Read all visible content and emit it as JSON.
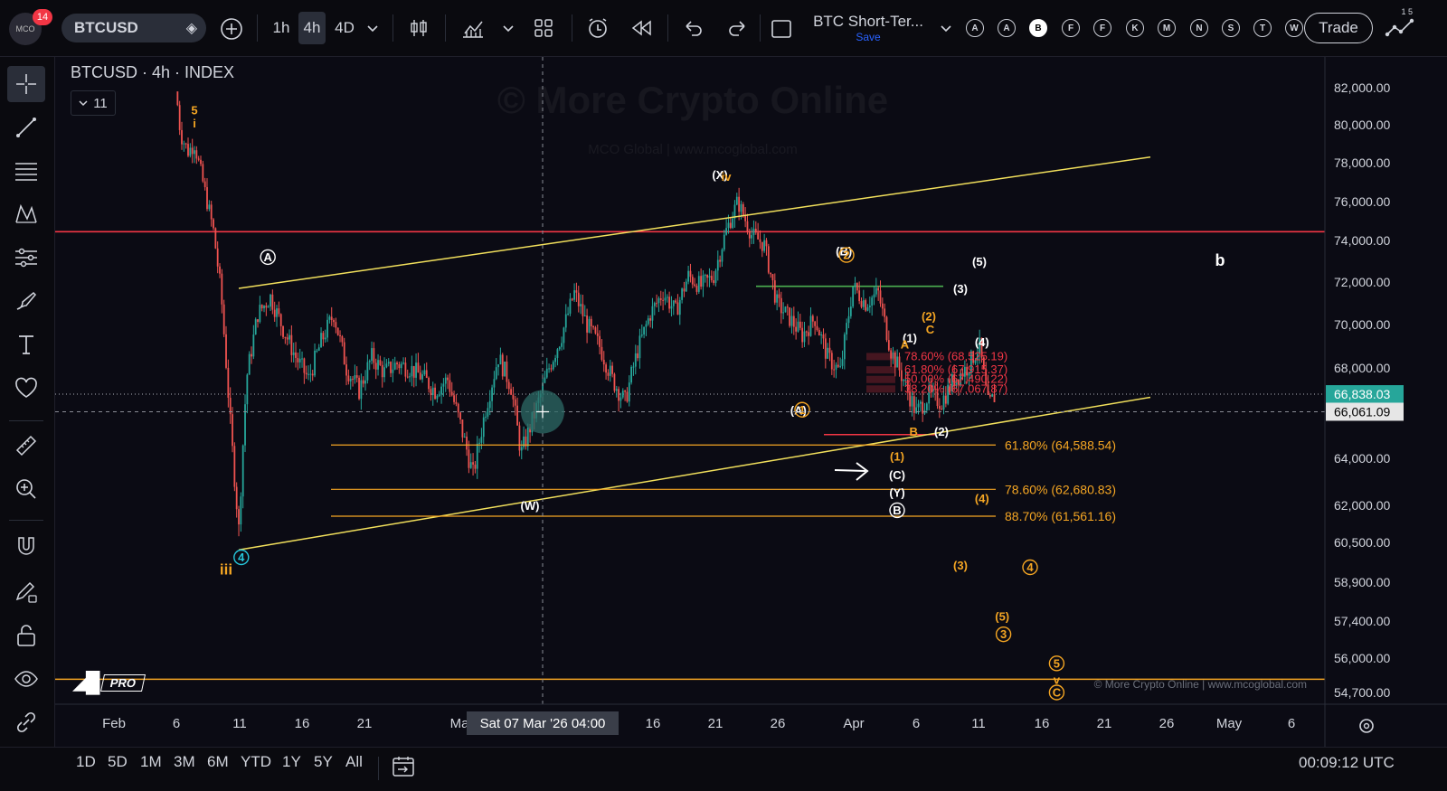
{
  "topbar": {
    "avatar_badge": "14",
    "symbol": "BTCUSD",
    "intervals": [
      "1h",
      "4h",
      "4D"
    ],
    "active_interval": "4h",
    "layout_name": "BTC Short-Ter...",
    "save_label": "Save",
    "letter_buttons": [
      "A",
      "A",
      "B",
      "F",
      "F",
      "K",
      "M",
      "N",
      "S",
      "T",
      "W"
    ],
    "active_letter": "B",
    "trade_label": "Trade",
    "corner_numbers": "1 5"
  },
  "chart_header": {
    "title": "BTCUSD · 4h · INDEX",
    "collapse_count": "11"
  },
  "watermark": {
    "main": "© More Crypto Online",
    "sub": "MCO Global  |  www.mcoglobal.com",
    "footer": "© More Crypto Online  |  www.mcoglobal.com",
    "logo_text": "PRO"
  },
  "crosshair": {
    "date_label": "Sat 07 Mar '26   04:00",
    "price_label": "66,061.09"
  },
  "bottombar": {
    "ranges": [
      "1D",
      "5D",
      "1M",
      "3M",
      "6M",
      "YTD",
      "1Y",
      "5Y",
      "All"
    ],
    "clock": "00:09:12 UTC"
  },
  "chart_data": {
    "type": "candlestick",
    "symbol": "BTCUSD",
    "interval": "4h",
    "ylim": [
      54000,
      83000
    ],
    "y_ticks": [
      82000,
      80000,
      78000,
      76000,
      74000,
      72000,
      70000,
      68000,
      64000,
      62000,
      60500,
      58900,
      57400,
      56000,
      54700
    ],
    "y_tick_labels": [
      "82,000.00",
      "80,000.00",
      "78,000.00",
      "76,000.00",
      "74,000.00",
      "72,000.00",
      "70,000.00",
      "68,000.00",
      "64,000.00",
      "62,000.00",
      "60,500.00",
      "58,900.00",
      "57,400.00",
      "56,000.00",
      "54,700.00"
    ],
    "x_tick_labels": [
      "Feb",
      "6",
      "11",
      "16",
      "21",
      "Ma",
      "16",
      "21",
      "26",
      "Apr",
      "6",
      "11",
      "16",
      "21",
      "26",
      "May",
      "6"
    ],
    "last_price": 66838.03,
    "last_price_label": "66,838.03",
    "price_path": [
      {
        "d": 0.0,
        "p": 82200
      },
      {
        "d": 0.4,
        "p": 79500
      },
      {
        "d": 1.0,
        "p": 78600
      },
      {
        "d": 1.5,
        "p": 79000
      },
      {
        "d": 2.0,
        "p": 77500
      },
      {
        "d": 3.0,
        "p": 74500
      },
      {
        "d": 3.6,
        "p": 71500
      },
      {
        "d": 4.4,
        "p": 65000
      },
      {
        "d": 5.0,
        "p": 61000
      },
      {
        "d": 5.6,
        "p": 67500
      },
      {
        "d": 6.5,
        "p": 70500
      },
      {
        "d": 7.5,
        "p": 71300
      },
      {
        "d": 8.5,
        "p": 69800
      },
      {
        "d": 9.5,
        "p": 68500
      },
      {
        "d": 10.5,
        "p": 67500
      },
      {
        "d": 11.5,
        "p": 69200
      },
      {
        "d": 12.5,
        "p": 70500
      },
      {
        "d": 13.5,
        "p": 68000
      },
      {
        "d": 14.5,
        "p": 67000
      },
      {
        "d": 15.5,
        "p": 68500
      },
      {
        "d": 16.5,
        "p": 67800
      },
      {
        "d": 17.5,
        "p": 68200
      },
      {
        "d": 18.5,
        "p": 68000
      },
      {
        "d": 19.5,
        "p": 67600
      },
      {
        "d": 20.5,
        "p": 67000
      },
      {
        "d": 21.5,
        "p": 67500
      },
      {
        "d": 22.5,
        "p": 65500
      },
      {
        "d": 23.5,
        "p": 63300
      },
      {
        "d": 24.5,
        "p": 66200
      },
      {
        "d": 25.5,
        "p": 68500
      },
      {
        "d": 26.5,
        "p": 67200
      },
      {
        "d": 27.3,
        "p": 64200
      },
      {
        "d": 28.5,
        "p": 66200
      },
      {
        "d": 29.5,
        "p": 68000
      },
      {
        "d": 30.5,
        "p": 69500
      },
      {
        "d": 31.5,
        "p": 71500
      },
      {
        "d": 32.5,
        "p": 70000
      },
      {
        "d": 33.5,
        "p": 69000
      },
      {
        "d": 34.5,
        "p": 67500
      },
      {
        "d": 35.5,
        "p": 66500
      },
      {
        "d": 36.5,
        "p": 68800
      },
      {
        "d": 37.5,
        "p": 70500
      },
      {
        "d": 38.5,
        "p": 71500
      },
      {
        "d": 39.5,
        "p": 70600
      },
      {
        "d": 40.5,
        "p": 72300
      },
      {
        "d": 41.5,
        "p": 71800
      },
      {
        "d": 42.5,
        "p": 72300
      },
      {
        "d": 43.5,
        "p": 74500
      },
      {
        "d": 44.4,
        "p": 76000
      },
      {
        "d": 45.5,
        "p": 74300
      },
      {
        "d": 46.5,
        "p": 73800
      },
      {
        "d": 47.5,
        "p": 71000
      },
      {
        "d": 48.5,
        "p": 70300
      },
      {
        "d": 49.5,
        "p": 69500
      },
      {
        "d": 50.5,
        "p": 70300
      },
      {
        "d": 51.5,
        "p": 68500
      },
      {
        "d": 52.5,
        "p": 67800
      },
      {
        "d": 53.5,
        "p": 71800
      },
      {
        "d": 54.5,
        "p": 71000
      },
      {
        "d": 55.5,
        "p": 71500
      },
      {
        "d": 56.5,
        "p": 68800
      },
      {
        "d": 57.5,
        "p": 67500
      },
      {
        "d": 58.5,
        "p": 66000
      },
      {
        "d": 59.5,
        "p": 66800
      },
      {
        "d": 60.5,
        "p": 66500
      },
      {
        "d": 61.5,
        "p": 67500
      },
      {
        "d": 62.5,
        "p": 68000
      },
      {
        "d": 63.5,
        "p": 69000
      },
      {
        "d": 64.2,
        "p": 66300
      },
      {
        "d": 64.8,
        "p": 66838
      }
    ],
    "horizontal_lines": [
      {
        "price": 74450,
        "color": "#f23645"
      },
      {
        "price": 65050,
        "color": "#f23645"
      },
      {
        "price": 55200,
        "color": "#f5a623"
      },
      {
        "price": 71800,
        "color": "#4caf50"
      }
    ],
    "zones": [
      {
        "from": 61500,
        "to": 64900,
        "color": "#8a5a17"
      }
    ],
    "trendlines": [
      {
        "from": {
          "d": 5.0,
          "p": 60200
        },
        "to": {
          "d": 77.0,
          "p": 66700
        },
        "color": "#f2e05c"
      },
      {
        "from": {
          "d": 5.0,
          "p": 71700
        },
        "to": {
          "d": 77.0,
          "p": 78300
        },
        "color": "#f2e05c"
      }
    ],
    "fib_levels": [
      {
        "label": "61.80% (64,588.54)",
        "price": 64588.54,
        "color": "#f5a623"
      },
      {
        "label": "78.60% (62,680.83)",
        "price": 62680.83,
        "color": "#f5a623"
      },
      {
        "label": "88.70% (61,561.16)",
        "price": 61561.16,
        "color": "#f5a623"
      },
      {
        "label": "78.60% (68,525.19)",
        "price": 68525.19,
        "color": "#f23645"
      },
      {
        "label": "61.80% (67,915.37)",
        "price": 67915.37,
        "color": "#f23645"
      },
      {
        "label": "50.00% (67,490.22)",
        "price": 67490.22,
        "color": "#f23645"
      },
      {
        "label": "38.20% (67,067.87)",
        "price": 67067.87,
        "color": "#f23645"
      }
    ],
    "wave_labels": [
      {
        "t": "5",
        "d": 1.5,
        "p": 80800,
        "c": "#f5a623"
      },
      {
        "t": "i",
        "d": 1.5,
        "p": 80100,
        "c": "#f5a623"
      },
      {
        "t": "iii",
        "d": 4.0,
        "p": 59400,
        "c": "#f5a623"
      },
      {
        "t": "4",
        "d": 5.2,
        "p": 59900,
        "c": "#26c6da",
        "circle": true
      },
      {
        "t": "A",
        "d": 7.3,
        "p": 73200,
        "c": "#ffffff",
        "circle": true
      },
      {
        "t": "(W)",
        "d": 28.0,
        "p": 62000,
        "c": "#ffffff"
      },
      {
        "t": "(X)",
        "d": 43.0,
        "p": 77400,
        "c": "#ffffff"
      },
      {
        "t": "iv",
        "d": 43.5,
        "p": 77300,
        "c": "#f5a623"
      },
      {
        "t": "(B)",
        "d": 52.8,
        "p": 73500,
        "c": "#ffffff"
      },
      {
        "t": "2",
        "d": 53.0,
        "p": 73300,
        "c": "#f5a623",
        "circle": true
      },
      {
        "t": "(A)",
        "d": 49.2,
        "p": 66150,
        "c": "#ffffff"
      },
      {
        "t": "1",
        "d": 49.5,
        "p": 66150,
        "c": "#f5a623",
        "circle": true
      },
      {
        "t": "(5)",
        "d": 63.5,
        "p": 73000,
        "c": "#ffffff"
      },
      {
        "t": "(3)",
        "d": 62.0,
        "p": 71700,
        "c": "#ffffff"
      },
      {
        "t": "(2)",
        "d": 59.5,
        "p": 70400,
        "c": "#f5a623"
      },
      {
        "t": "C",
        "d": 59.6,
        "p": 69800,
        "c": "#f5a623"
      },
      {
        "t": "(1)",
        "d": 58.0,
        "p": 69400,
        "c": "#ffffff"
      },
      {
        "t": "A",
        "d": 57.6,
        "p": 69100,
        "c": "#f5a623"
      },
      {
        "t": "(4)",
        "d": 63.7,
        "p": 69200,
        "c": "#ffffff"
      },
      {
        "t": "B",
        "d": 58.3,
        "p": 65200,
        "c": "#f5a623"
      },
      {
        "t": "(2)",
        "d": 60.5,
        "p": 65200,
        "c": "#ffffff"
      },
      {
        "t": "(1)",
        "d": 57.0,
        "p": 64100,
        "c": "#f5a623"
      },
      {
        "t": "(C)",
        "d": 57.0,
        "p": 63300,
        "c": "#ffffff"
      },
      {
        "t": "(Y)",
        "d": 57.0,
        "p": 62550,
        "c": "#ffffff"
      },
      {
        "t": "B",
        "d": 57.0,
        "p": 61800,
        "c": "#ffffff",
        "circle": true
      },
      {
        "t": "(4)",
        "d": 63.7,
        "p": 62300,
        "c": "#f5a623"
      },
      {
        "t": "(3)",
        "d": 62.0,
        "p": 59600,
        "c": "#f5a623"
      },
      {
        "t": "4",
        "d": 67.5,
        "p": 59500,
        "c": "#f5a623",
        "circle": true
      },
      {
        "t": "(5)",
        "d": 65.3,
        "p": 57600,
        "c": "#f5a623"
      },
      {
        "t": "3",
        "d": 65.4,
        "p": 56900,
        "c": "#f5a623",
        "circle": true
      },
      {
        "t": "5",
        "d": 69.6,
        "p": 55800,
        "c": "#f5a623",
        "circle": true
      },
      {
        "t": "v",
        "d": 69.6,
        "p": 55200,
        "c": "#f5a623"
      },
      {
        "t": "C",
        "d": 69.6,
        "p": 54700,
        "c": "#f5a623",
        "circle": true
      },
      {
        "t": "b",
        "d": 82.5,
        "p": 73000,
        "c": "#ffffff"
      }
    ]
  }
}
